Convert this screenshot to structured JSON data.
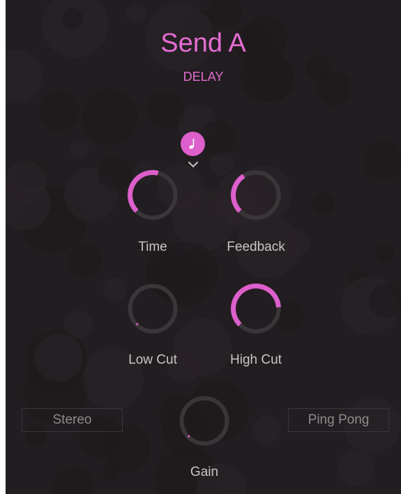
{
  "header": {
    "title": "Send A",
    "subtitle": "DELAY"
  },
  "sync": {
    "icon": "music-note-icon",
    "glyph": "♩",
    "dropdown_icon": "chevron-down-icon"
  },
  "knobs": [
    {
      "id": "time",
      "label": "Time",
      "value": 0.55
    },
    {
      "id": "feedback",
      "label": "Feedback",
      "value": 0.38
    },
    {
      "id": "low-cut",
      "label": "Low Cut",
      "value": 0.0
    },
    {
      "id": "high-cut",
      "label": "High Cut",
      "value": 0.82
    },
    {
      "id": "gain",
      "label": "Gain",
      "value": 0.0
    }
  ],
  "buttons": {
    "stereo": "Stereo",
    "ping_pong": "Ping Pong"
  },
  "colors": {
    "accent": "#dd5fcb",
    "track": "#3a3538",
    "background": "#221d20"
  }
}
